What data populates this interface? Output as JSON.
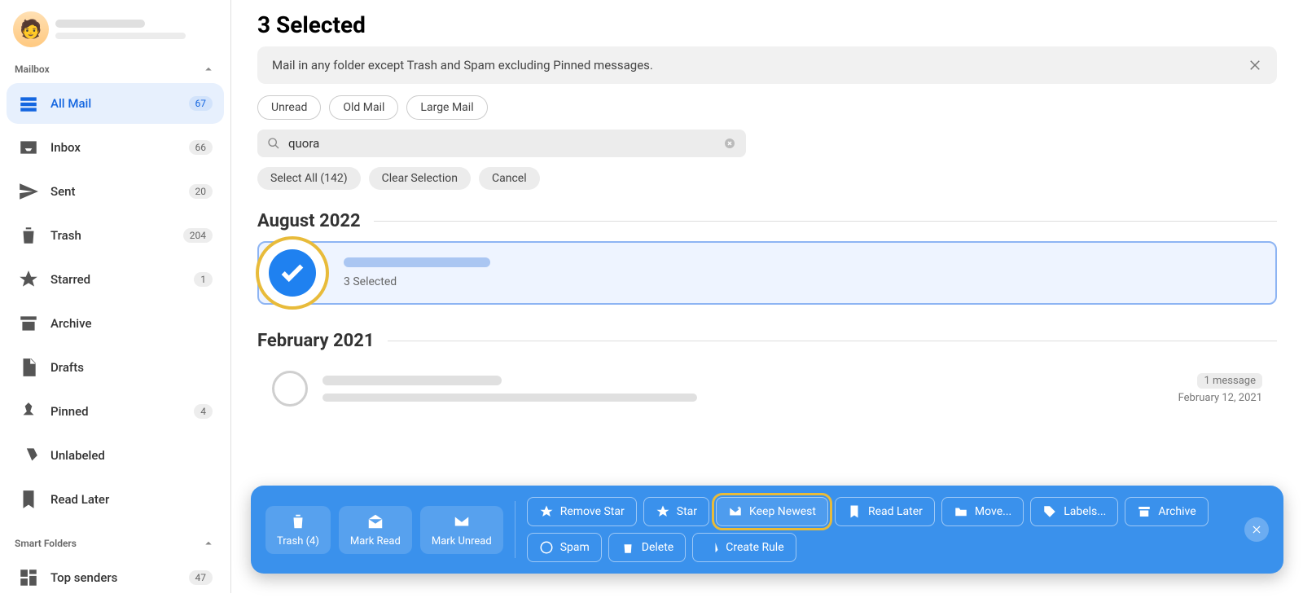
{
  "sidebar": {
    "section1": "Mailbox",
    "section2": "Smart Folders",
    "items": [
      {
        "label": "All Mail",
        "count": "67",
        "active": true
      },
      {
        "label": "Inbox",
        "count": "66"
      },
      {
        "label": "Sent",
        "count": "20"
      },
      {
        "label": "Trash",
        "count": "204"
      },
      {
        "label": "Starred",
        "count": "1"
      },
      {
        "label": "Archive",
        "count": ""
      },
      {
        "label": "Drafts",
        "count": ""
      },
      {
        "label": "Pinned",
        "count": "4"
      },
      {
        "label": "Unlabeled",
        "count": ""
      },
      {
        "label": "Read Later",
        "count": ""
      }
    ],
    "smart": [
      {
        "label": "Top senders",
        "count": "47"
      }
    ]
  },
  "header": {
    "title": "3 Selected",
    "info": "Mail in any folder except Trash and Spam excluding Pinned messages."
  },
  "filters": {
    "unread": "Unread",
    "old": "Old Mail",
    "large": "Large Mail"
  },
  "search": {
    "value": "quora"
  },
  "selection": {
    "select_all": "Select All (142)",
    "clear": "Clear Selection",
    "cancel": "Cancel"
  },
  "groups": {
    "g1": "August 2022",
    "g2": "February 2021"
  },
  "thread1": {
    "sub": "3 Selected"
  },
  "thread2": {
    "count": "1 message",
    "date": "February 12, 2021"
  },
  "actions": {
    "trash": "Trash (4)",
    "mark_read": "Mark Read",
    "mark_unread": "Mark Unread",
    "remove_star": "Remove Star",
    "star": "Star",
    "keep_newest": "Keep Newest",
    "read_later": "Read Later",
    "move": "Move...",
    "labels": "Labels...",
    "archive": "Archive",
    "spam": "Spam",
    "delete": "Delete",
    "create_rule": "Create Rule"
  }
}
